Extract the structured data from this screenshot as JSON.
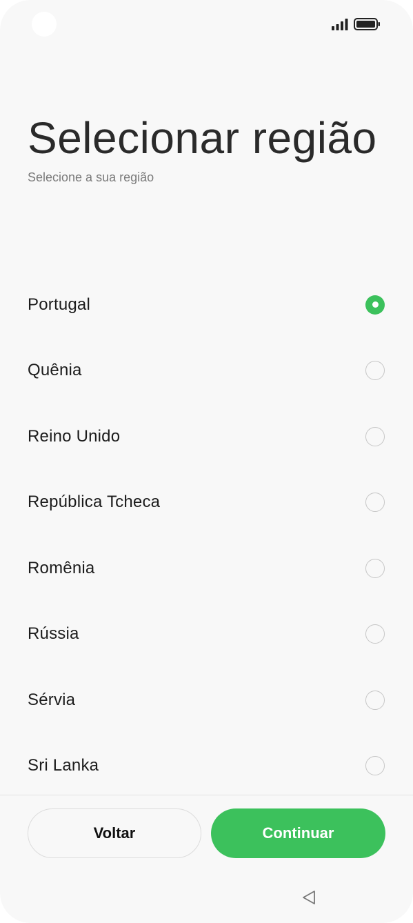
{
  "status_bar": {
    "icons": [
      "camera-cutout",
      "signal-icon",
      "battery-icon"
    ]
  },
  "header": {
    "title": "Selecionar região",
    "subtitle": "Selecione a sua região"
  },
  "regions": {
    "selected_index": 0,
    "items": [
      {
        "label": "Portugal",
        "selected": true
      },
      {
        "label": "Quênia",
        "selected": false
      },
      {
        "label": "Reino Unido",
        "selected": false
      },
      {
        "label": "República Tcheca",
        "selected": false
      },
      {
        "label": "Romênia",
        "selected": false
      },
      {
        "label": "Rússia",
        "selected": false
      },
      {
        "label": "Sérvia",
        "selected": false
      },
      {
        "label": "Sri Lanka",
        "selected": false
      }
    ]
  },
  "footer": {
    "back_label": "Voltar",
    "continue_label": "Continuar"
  },
  "nav": {
    "back_icon": "triangle-left-icon"
  },
  "colors": {
    "accent": "#3cc15c",
    "background": "#f8f8f8",
    "radio_border": "#c6c6c6"
  }
}
